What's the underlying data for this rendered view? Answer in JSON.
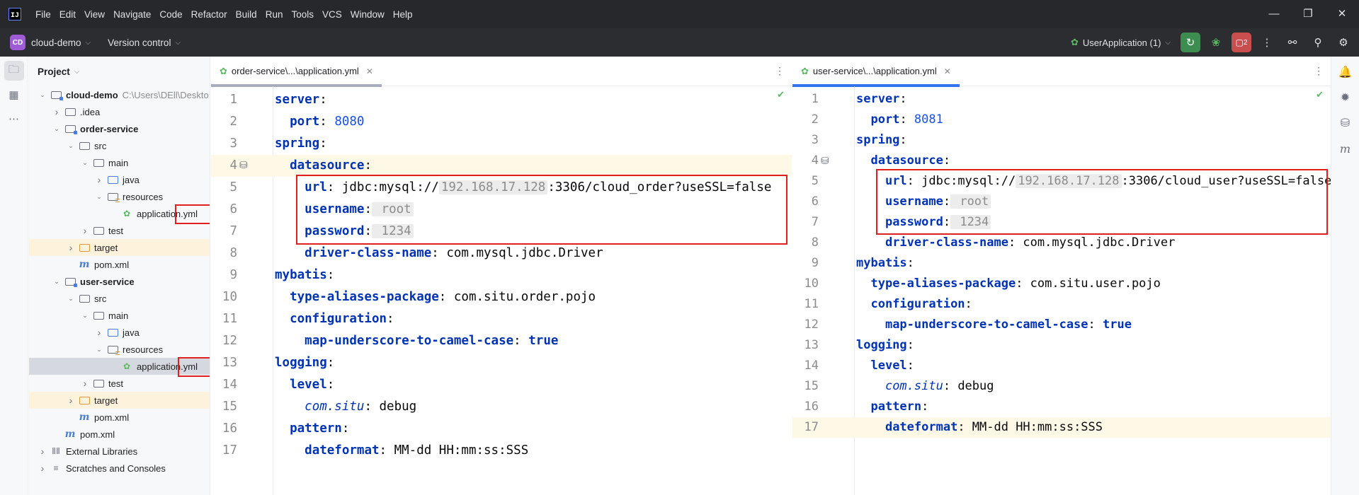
{
  "titlebar": {
    "logo": "IJ",
    "menu": [
      "File",
      "Edit",
      "View",
      "Navigate",
      "Code",
      "Refactor",
      "Build",
      "Run",
      "Tools",
      "VCS",
      "Window",
      "Help"
    ],
    "window_controls": [
      "minimize-icon",
      "restore-icon",
      "close-icon"
    ]
  },
  "toolbar": {
    "project_badge": "CD",
    "project_name": "cloud-demo",
    "vcs_label": "Version control",
    "run_config": "UserApplication (1)",
    "services_badge": "2"
  },
  "project_panel": {
    "title": "Project",
    "tree": [
      {
        "label": "cloud-demo",
        "path": "C:\\Users\\DEll\\Deskto",
        "icon": "module-folder-icon",
        "bold": true,
        "arrow": "expanded"
      },
      {
        "label": ".idea",
        "icon": "folder-icon",
        "arrow": "collapsed"
      },
      {
        "label": "order-service",
        "icon": "module-folder-icon",
        "bold": true,
        "arrow": "expanded"
      },
      {
        "label": "src",
        "icon": "folder-icon",
        "arrow": "expanded"
      },
      {
        "label": "main",
        "icon": "folder-icon",
        "arrow": "expanded"
      },
      {
        "label": "java",
        "icon": "source-folder-icon",
        "arrow": "collapsed"
      },
      {
        "label": "resources",
        "icon": "resources-folder-icon",
        "arrow": "expanded"
      },
      {
        "label": "application.yml",
        "icon": "yaml-spring-icon",
        "boxed": true
      },
      {
        "label": "test",
        "icon": "folder-icon",
        "arrow": "collapsed"
      },
      {
        "label": "target",
        "icon": "excluded-folder-icon",
        "arrow": "collapsed",
        "highlight": true
      },
      {
        "label": "pom.xml",
        "icon": "maven-icon"
      },
      {
        "label": "user-service",
        "icon": "module-folder-icon",
        "bold": true,
        "arrow": "expanded"
      },
      {
        "label": "src",
        "icon": "folder-icon",
        "arrow": "expanded"
      },
      {
        "label": "main",
        "icon": "folder-icon",
        "arrow": "expanded"
      },
      {
        "label": "java",
        "icon": "source-folder-icon",
        "arrow": "collapsed"
      },
      {
        "label": "resources",
        "icon": "resources-folder-icon",
        "arrow": "expanded"
      },
      {
        "label": "application.yml",
        "icon": "yaml-spring-icon",
        "boxed": true,
        "selected": true
      },
      {
        "label": "test",
        "icon": "folder-icon",
        "arrow": "collapsed"
      },
      {
        "label": "target",
        "icon": "excluded-folder-icon",
        "arrow": "collapsed",
        "highlight": true
      },
      {
        "label": "pom.xml",
        "icon": "maven-icon"
      },
      {
        "label": "pom.xml",
        "icon": "maven-icon"
      },
      {
        "label": "External Libraries",
        "icon": "library-icon",
        "arrow": "collapsed"
      },
      {
        "label": "Scratches and Consoles",
        "icon": "scratches-icon",
        "arrow": "collapsed"
      }
    ]
  },
  "editors": [
    {
      "tab_label": "order-service\\...\\application.yml",
      "tab_accent": "#a8adbd",
      "current_line": 4,
      "lines": [
        [
          [
            "k",
            "server"
          ],
          [
            "p",
            ":"
          ]
        ],
        [
          [
            "i",
            "  "
          ],
          [
            "k",
            "port"
          ],
          [
            "p",
            ": "
          ],
          [
            "num",
            "8080"
          ]
        ],
        [
          [
            "k",
            "spring"
          ],
          [
            "p",
            ":"
          ]
        ],
        [
          [
            "i",
            "  "
          ],
          [
            "k",
            "datasource"
          ],
          [
            "p",
            ":"
          ]
        ],
        [
          [
            "i",
            "    "
          ],
          [
            "k",
            "url"
          ],
          [
            "p",
            ": jdbc:mysql://"
          ],
          [
            "hint",
            "192.168.17.128"
          ],
          [
            "p",
            ":3306/cloud_order?useSSL=false"
          ]
        ],
        [
          [
            "i",
            "    "
          ],
          [
            "k",
            "username"
          ],
          [
            "p",
            ":"
          ],
          [
            "hint",
            " root"
          ]
        ],
        [
          [
            "i",
            "    "
          ],
          [
            "k",
            "password"
          ],
          [
            "p",
            ":"
          ],
          [
            "hint",
            " 1234"
          ]
        ],
        [
          [
            "i",
            "    "
          ],
          [
            "k",
            "driver-class-name"
          ],
          [
            "p",
            ": com.mysql.jdbc.Driver"
          ]
        ],
        [
          [
            "k",
            "mybatis"
          ],
          [
            "p",
            ":"
          ]
        ],
        [
          [
            "i",
            "  "
          ],
          [
            "k",
            "type-aliases-package"
          ],
          [
            "p",
            ": com.situ.order.pojo"
          ]
        ],
        [
          [
            "i",
            "  "
          ],
          [
            "k",
            "configuration"
          ],
          [
            "p",
            ":"
          ]
        ],
        [
          [
            "i",
            "    "
          ],
          [
            "k",
            "map-underscore-to-camel-case"
          ],
          [
            "p",
            ": "
          ],
          [
            "b",
            "true"
          ]
        ],
        [
          [
            "k",
            "logging"
          ],
          [
            "p",
            ":"
          ]
        ],
        [
          [
            "i",
            "  "
          ],
          [
            "k",
            "level"
          ],
          [
            "p",
            ":"
          ]
        ],
        [
          [
            "i",
            "    "
          ],
          [
            "ital",
            "com.situ"
          ],
          [
            "p",
            ": debug"
          ]
        ],
        [
          [
            "i",
            "  "
          ],
          [
            "k",
            "pattern"
          ],
          [
            "p",
            ":"
          ]
        ],
        [
          [
            "i",
            "    "
          ],
          [
            "k",
            "dateformat"
          ],
          [
            "p",
            ": MM-dd HH:mm:ss:SSS"
          ]
        ]
      ]
    },
    {
      "tab_label": "user-service\\...\\application.yml",
      "tab_accent": "#3574f0",
      "current_line": 17,
      "lines": [
        [
          [
            "k",
            "server"
          ],
          [
            "p",
            ":"
          ]
        ],
        [
          [
            "i",
            "  "
          ],
          [
            "k",
            "port"
          ],
          [
            "p",
            ": "
          ],
          [
            "num",
            "8081"
          ]
        ],
        [
          [
            "k",
            "spring"
          ],
          [
            "p",
            ":"
          ]
        ],
        [
          [
            "i",
            "  "
          ],
          [
            "k",
            "datasource"
          ],
          [
            "p",
            ":"
          ]
        ],
        [
          [
            "i",
            "    "
          ],
          [
            "k",
            "url"
          ],
          [
            "p",
            ": jdbc:mysql://"
          ],
          [
            "hint",
            "192.168.17.128"
          ],
          [
            "p",
            ":3306/cloud_user?useSSL=false"
          ]
        ],
        [
          [
            "i",
            "    "
          ],
          [
            "k",
            "username"
          ],
          [
            "p",
            ":"
          ],
          [
            "hint",
            " root"
          ]
        ],
        [
          [
            "i",
            "    "
          ],
          [
            "k",
            "password"
          ],
          [
            "p",
            ":"
          ],
          [
            "hint",
            " 1234"
          ]
        ],
        [
          [
            "i",
            "    "
          ],
          [
            "k",
            "driver-class-name"
          ],
          [
            "p",
            ": com.mysql.jdbc.Driver"
          ]
        ],
        [
          [
            "k",
            "mybatis"
          ],
          [
            "p",
            ":"
          ]
        ],
        [
          [
            "i",
            "  "
          ],
          [
            "k",
            "type-aliases-package"
          ],
          [
            "p",
            ": com.situ.user.pojo"
          ]
        ],
        [
          [
            "i",
            "  "
          ],
          [
            "k",
            "configuration"
          ],
          [
            "p",
            ":"
          ]
        ],
        [
          [
            "i",
            "    "
          ],
          [
            "k",
            "map-underscore-to-camel-case"
          ],
          [
            "p",
            ": "
          ],
          [
            "b",
            "true"
          ]
        ],
        [
          [
            "k",
            "logging"
          ],
          [
            "p",
            ":"
          ]
        ],
        [
          [
            "i",
            "  "
          ],
          [
            "k",
            "level"
          ],
          [
            "p",
            ":"
          ]
        ],
        [
          [
            "i",
            "    "
          ],
          [
            "ital",
            "com.situ"
          ],
          [
            "p",
            ": debug"
          ]
        ],
        [
          [
            "i",
            "  "
          ],
          [
            "k",
            "pattern"
          ],
          [
            "p",
            ":"
          ]
        ],
        [
          [
            "i",
            "    "
          ],
          [
            "k",
            "dateformat"
          ],
          [
            "p",
            ": MM-dd HH:mm:ss:SSS"
          ]
        ]
      ]
    }
  ],
  "colors": {
    "titlebar_bg": "#27282c",
    "toolbar_bg": "#2b2d30",
    "keyword": "#0033b3",
    "number": "#1750eb",
    "annotation_box": "#e02020",
    "current_line_bg": "#fdf9e6",
    "excluded_row_bg": "#fdf2dc"
  }
}
